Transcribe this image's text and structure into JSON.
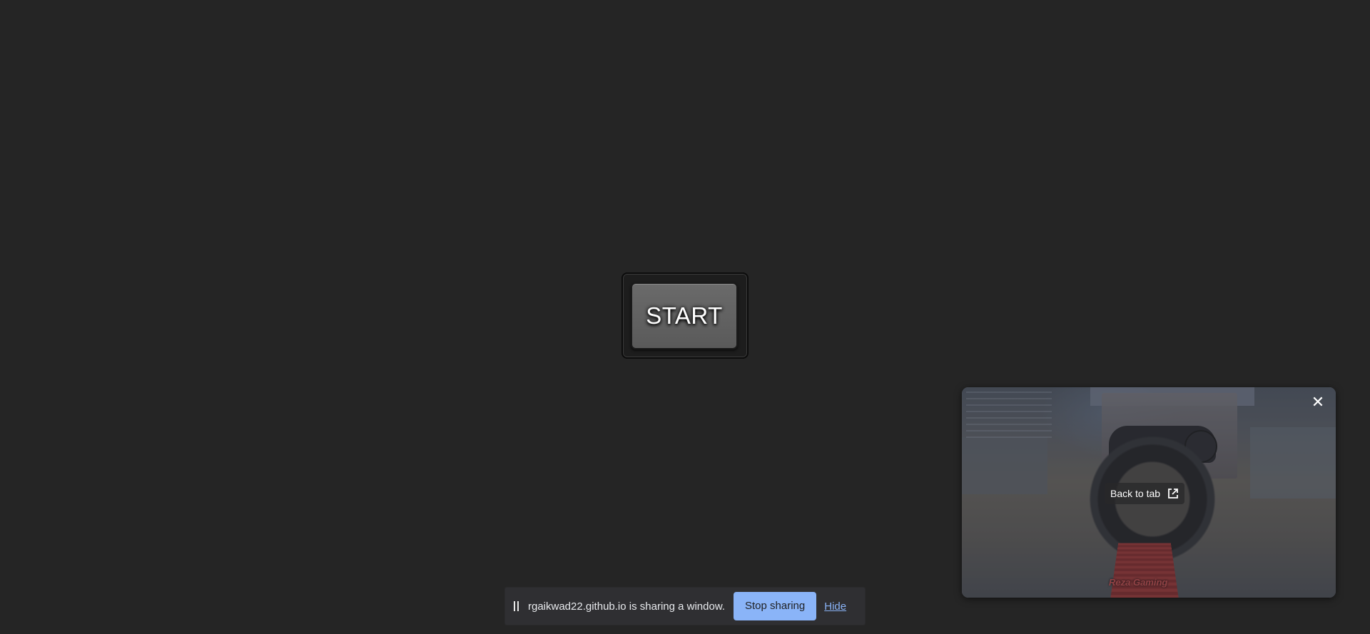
{
  "start_button": {
    "label": "START"
  },
  "preview": {
    "back_to_tab_label": "Back to tab",
    "close_glyph": "✕",
    "watermark": "Reza Gaming",
    "icons": {
      "open_in_new": "open-in-new-icon",
      "close": "close-icon"
    }
  },
  "share_bar": {
    "message": "rgaikwad22.github.io is sharing a window.",
    "stop_label": "Stop sharing",
    "hide_label": "Hide",
    "accent_color": "#8ab4f8"
  }
}
